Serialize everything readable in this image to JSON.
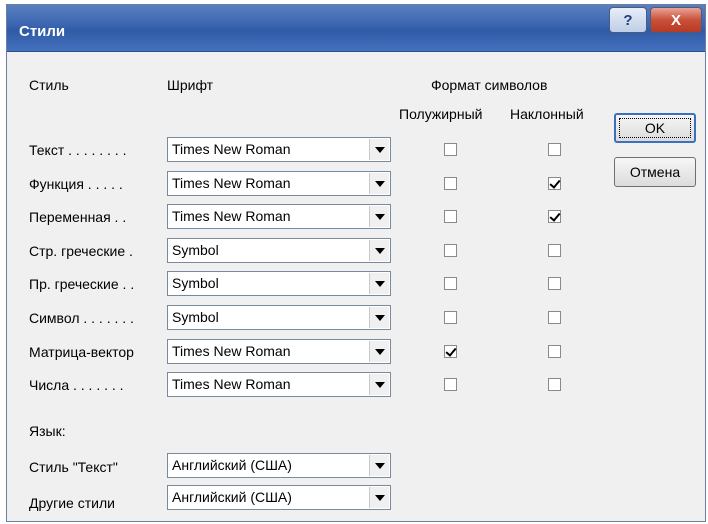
{
  "dialog": {
    "title": "Стили",
    "help_glyph": "?",
    "close_glyph": "X"
  },
  "headers": {
    "style": "Стиль",
    "font": "Шрифт",
    "format": "Формат символов",
    "bold": "Полужирный",
    "italic": "Наклонный"
  },
  "rows": [
    {
      "label": "Текст . . . . . . . .",
      "font": "Times New Roman",
      "bold": false,
      "italic": false
    },
    {
      "label": "Функция . . . . .",
      "font": "Times New Roman",
      "bold": false,
      "italic": true
    },
    {
      "label": "Переменная . .",
      "font": "Times New Roman",
      "bold": false,
      "italic": true
    },
    {
      "label": "Стр. греческие .",
      "font": "Symbol",
      "bold": false,
      "italic": false
    },
    {
      "label": "Пр. греческие . .",
      "font": "Symbol",
      "bold": false,
      "italic": false
    },
    {
      "label": "Символ . . . . . . .",
      "font": "Symbol",
      "bold": false,
      "italic": false
    },
    {
      "label": "Матрица-вектор",
      "font": "Times New Roman",
      "bold": true,
      "italic": false
    },
    {
      "label": "Числа . . . . . . .",
      "font": "Times New Roman",
      "bold": false,
      "italic": false
    }
  ],
  "language": {
    "heading": "Язык:",
    "text_style_label": "Стиль \"Текст\"",
    "text_style_value": "Английский (США)",
    "other_styles_label": "Другие стили",
    "other_styles_value": "Английский (США)"
  },
  "buttons": {
    "ok": "OK",
    "cancel": "Отмена"
  }
}
